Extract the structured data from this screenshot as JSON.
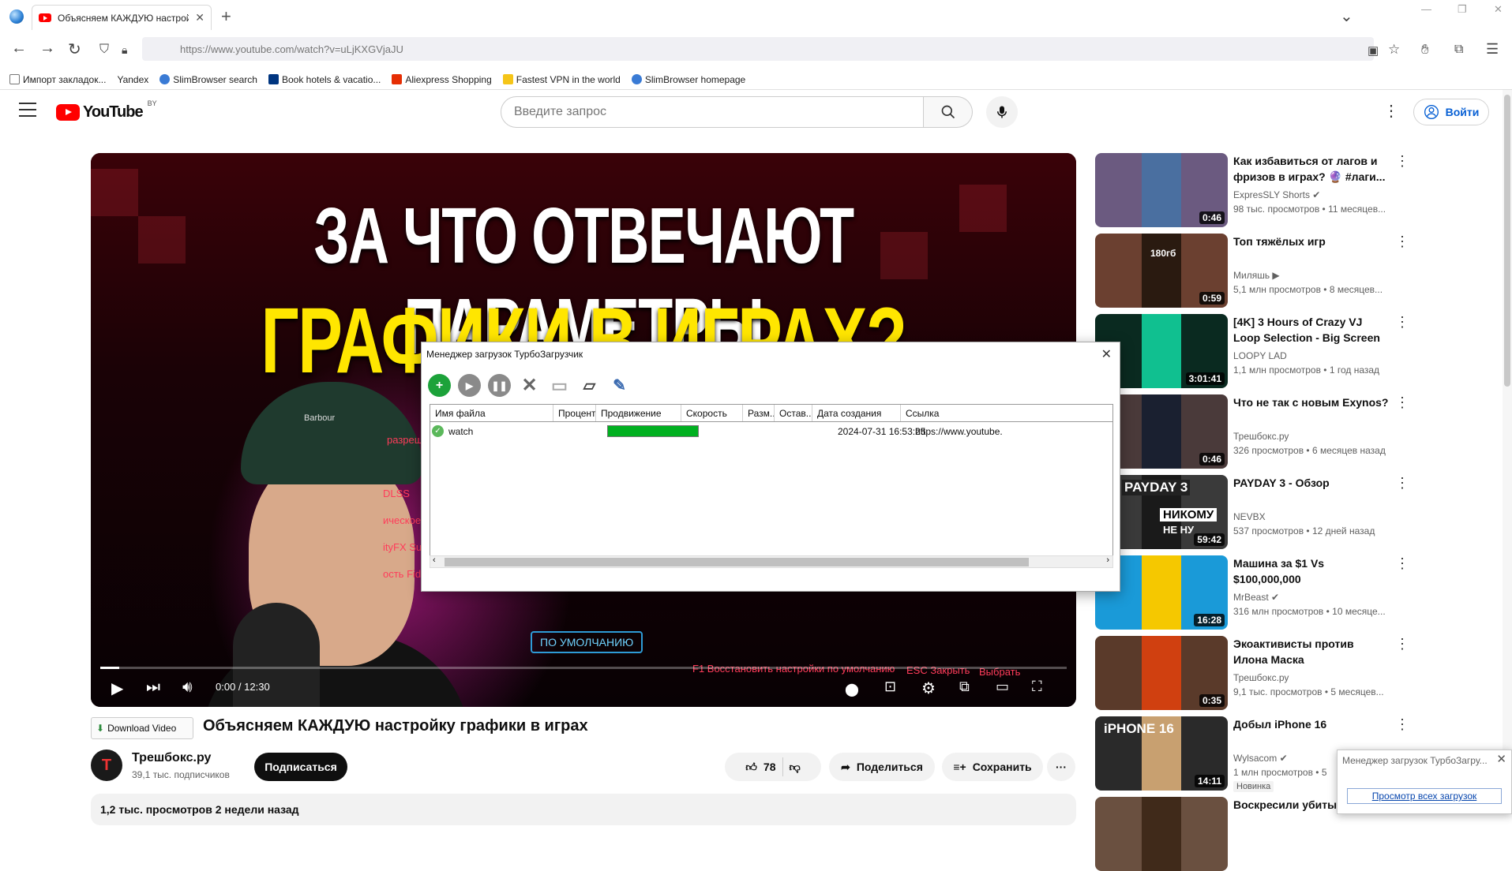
{
  "browser": {
    "tab_title": "Объясняем КАЖДУЮ настройку графики в играх",
    "url": "https://www.youtube.com/watch?v=uLjKXGVjaJU",
    "bookmarks": [
      {
        "label": "Импорт закладок...",
        "color": "#777777"
      },
      {
        "label": "Yandex",
        "color": "#ffffff"
      },
      {
        "label": "SlimBrowser search",
        "color": "#3a7bd5"
      },
      {
        "label": "Book hotels & vacatio...",
        "color": "#003580"
      },
      {
        "label": "Aliexpress Shopping",
        "color": "#e62e04"
      },
      {
        "label": "Fastest VPN in the world",
        "color": "#f5c518"
      },
      {
        "label": "SlimBrowser homepage",
        "color": "#3a7bd5"
      }
    ]
  },
  "youtube": {
    "logo_text": "YouTube",
    "region": "BY",
    "search_placeholder": "Введите запрос",
    "login_label": "Войти",
    "accent": "#ff0000",
    "player": {
      "thumb_line1": "ЗА ЧТО ОТВЕЧАЮТ ПАРАМЕТРЫ",
      "thumb_line2": "ГРАФИКИ В ИГРАХ?",
      "hud_default": "ПО УМОЛЧАНИЮ",
      "hud_restore": "F1 Восстановить настройки по умолчанию",
      "hud_close": "ESC Закрыть",
      "hud_select": "Выбрать",
      "hud_dlss": "DLSS",
      "hud_fx": "ityFX Super",
      "hud_fidelity": "ость Fidelity",
      "hud_res": "разреш",
      "hud_tech": "ическое р",
      "cap_brand": "Barbour",
      "time": "0:00 / 12:30",
      "progress_fraction": 0.02
    },
    "download_video_label": "Download Video",
    "video_title": "Объясняем КАЖДУЮ настройку графики в играх",
    "channel": {
      "avatar": "Т",
      "name": "Трешбокс.ру",
      "subs": "39,1 тыс. подписчиков"
    },
    "subscribe_label": "Подписаться",
    "likes": "78",
    "share_label": "Поделиться",
    "save_label": "Сохранить",
    "description_meta": "1,2 тыс. просмотров  2 недели назад",
    "recommendations": [
      {
        "title": "Как избавиться от лагов и фризов в играх? 🔮 #лаги...",
        "channel": "ExpresSLY Shorts ✔",
        "meta": "98 тыс. просмотров • 11 месяцев...",
        "duration": "0:46",
        "thumb_color": "#6b5a80",
        "inner_color": "#4a6fa0"
      },
      {
        "title": "Топ тяжёлых игр",
        "channel": "Миляшь ▶",
        "meta": "5,1 млн просмотров • 8 месяцев...",
        "duration": "0:59",
        "thumb_color": "#6b4030",
        "inner_color": "#2a1a10",
        "badge_text": "180гб"
      },
      {
        "title": "[4K] 3 Hours of Crazy VJ Loop Selection - Big Screen Visuals",
        "channel": "LOOPY LAD",
        "meta": "1,1 млн просмотров • 1 год назад",
        "duration": "3:01:41",
        "thumb_color": "#0a2a20",
        "inner_color": "#10c090"
      },
      {
        "title": "Что не так с новым Exynos?",
        "channel": "Трешбокс.ру",
        "meta": "326 просмотров • 6 месяцев назад",
        "duration": "0:46",
        "thumb_color": "#4a3a3a",
        "inner_color": "#1a2030"
      },
      {
        "title": "PAYDAY 3 - Обзор",
        "channel": "NEVBX",
        "meta": "537 просмотров • 12 дней назад",
        "duration": "59:42",
        "thumb_color": "#3a3a3a",
        "inner_color": "#1a1a1a",
        "overlay1": "PAYDAY 3",
        "overlay2": "НИКОМУ",
        "overlay3": "НЕ НУ"
      },
      {
        "title": "Машина за $1 Vs $100,000,000",
        "channel": "MrBeast ✔",
        "meta": "316 млн просмотров • 10 месяце...",
        "duration": "16:28",
        "thumb_color": "#1a9ad8",
        "inner_color": "#f5c800"
      },
      {
        "title": "Экоактивисты против Илона Маска",
        "channel": "Трешбокс.ру",
        "meta": "9,1 тыс. просмотров • 5 месяцев...",
        "duration": "0:35",
        "thumb_color": "#5a3a2a",
        "inner_color": "#d04010"
      },
      {
        "title": "Добыл iPhone 16",
        "channel": "Wylsacom ✔",
        "meta": "1 млн просмотров • 5",
        "duration": "14:11",
        "thumb_color": "#2a2a2a",
        "inner_color": "#c8a070",
        "badge": "Новинка",
        "overlay1": "iPHONE 16"
      },
      {
        "title": "Воскресили убитый",
        "channel": "",
        "meta": "",
        "duration": "",
        "thumb_color": "#6a5040",
        "inner_color": "#402a1a"
      }
    ]
  },
  "download_manager": {
    "title": "Менеджер загрузок ТурбоЗагрузчик",
    "columns": [
      "Имя файла",
      "Процент",
      "Продвижение",
      "Скорость",
      "Разм...",
      "Остав...",
      "Дата создания",
      "Ссылка"
    ],
    "rows": [
      {
        "name": "watch",
        "percent": "",
        "progress": 1.0,
        "speed": "",
        "size": "",
        "remaining": "",
        "created": "2024-07-31 16:53:25",
        "link": "https://www.youtube."
      }
    ],
    "progress_color": "#00b020"
  },
  "notification": {
    "title": "Менеджер загрузок ТурбоЗагру...",
    "link": "Просмотр всех загрузок"
  }
}
